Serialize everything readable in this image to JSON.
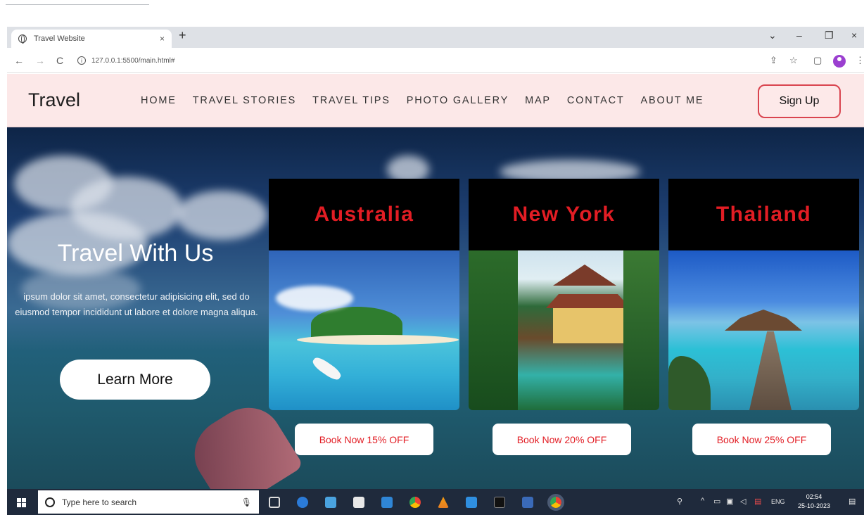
{
  "browser": {
    "tab_title": "Travel Website",
    "tab_close": "×",
    "new_tab": "+",
    "url": "127.0.0.1:5500/main.html#",
    "info": "i",
    "back": "←",
    "forward": "→",
    "reload": "C",
    "share": "⇪",
    "star": "☆",
    "sidepanel": "▢",
    "menu": "⋮",
    "win_chevron": "⌄",
    "win_min": "–",
    "win_restore": "❐",
    "win_close": "×"
  },
  "site": {
    "logo": "Travel",
    "nav": [
      {
        "label": "HOME"
      },
      {
        "label": "TRAVEL STORIES"
      },
      {
        "label": "TRAVEL TIPS"
      },
      {
        "label": "PHOTO GALLERY"
      },
      {
        "label": "MAP"
      },
      {
        "label": "CONTACT"
      },
      {
        "label": "ABOUT ME"
      }
    ],
    "signup": "Sign Up"
  },
  "hero": {
    "title": "Travel With Us",
    "text": "ipsum dolor sit amet, consectetur adipisicing elit, sed do eiusmod tempor incididunt ut labore et dolore magna aliqua.",
    "button": "Learn More"
  },
  "cards": [
    {
      "name": "Australia",
      "book": "Book Now 15% OFF"
    },
    {
      "name": "New York",
      "book": "Book Now 20% OFF"
    },
    {
      "name": "Thailand",
      "book": "Book Now 25% OFF"
    }
  ],
  "taskbar": {
    "search_placeholder": "Type here to search",
    "mic": "🎙",
    "lang": "ENG",
    "time": "02:54",
    "date": "25-10-2023"
  },
  "colors": {
    "header_bg": "#fce8e8",
    "accent_red": "#e21d24",
    "signup_border": "#d9444f",
    "taskbar": "#1f2a3c"
  }
}
